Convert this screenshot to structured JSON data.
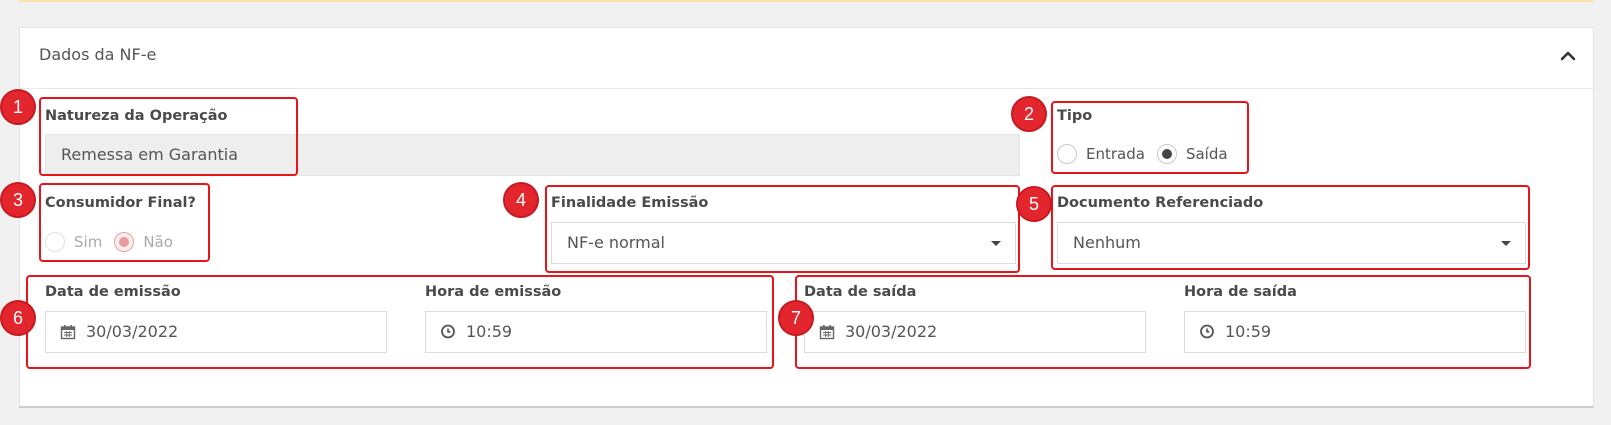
{
  "panel": {
    "title": "Dados da NF-e"
  },
  "natureza": {
    "label": "Natureza da Operação",
    "value": "Remessa em Garantia"
  },
  "tipo": {
    "label": "Tipo",
    "options": [
      "Entrada",
      "Saída"
    ],
    "selected": "Saída"
  },
  "consumidor": {
    "label": "Consumidor Final?",
    "options": [
      "Sim",
      "Não"
    ],
    "selected": "Não"
  },
  "finalidade": {
    "label": "Finalidade Emissão",
    "value": "NF-e normal"
  },
  "documento": {
    "label": "Documento Referenciado",
    "value": "Nenhum"
  },
  "emissao": {
    "date_label": "Data de emissão",
    "date_value": "30/03/2022",
    "time_label": "Hora de emissão",
    "time_value": "10:59"
  },
  "saida": {
    "date_label": "Data de saída",
    "date_value": "30/03/2022",
    "time_label": "Hora de saída",
    "time_value": "10:59"
  },
  "annotations": [
    "1",
    "2",
    "3",
    "4",
    "5",
    "6",
    "7"
  ],
  "colors": {
    "annotation_red": "#e3262d",
    "disabled_bg": "#eeeeee"
  }
}
